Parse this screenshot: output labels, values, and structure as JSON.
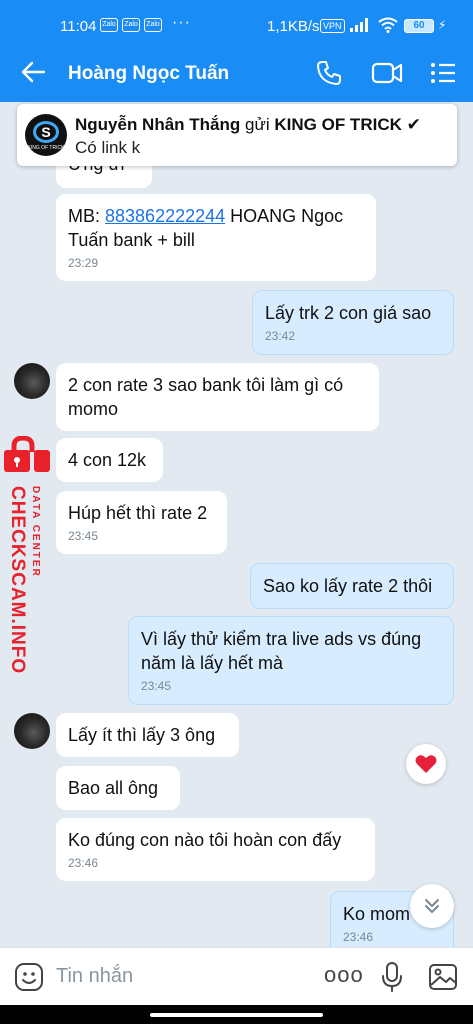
{
  "status_bar": {
    "time": "11:04",
    "app_icons": [
      "Zalo",
      "Zalo",
      "Zalo"
    ],
    "more": "···",
    "network_speed": "1,1KB/s",
    "vpn": "VPN",
    "battery": "60"
  },
  "header": {
    "contact_name": "Hoàng Ngọc Tuấn",
    "icons": [
      "back-arrow-icon",
      "phone-icon",
      "video-call-icon",
      "menu-list-icon"
    ]
  },
  "pinned_notification": {
    "sender": "Nguyễn Nhân Thắng",
    "action": "gửi",
    "target": "KING OF TRICK",
    "check": "✔",
    "preview": "Có link k",
    "logo_text": "KING OF TRICK"
  },
  "messages": [
    {
      "side": "in",
      "text": "Ừng ừi",
      "time": ""
    },
    {
      "side": "in",
      "prefix": "MB: ",
      "link": "883862222244",
      "text_line1_rest": " HOANG Ngoc",
      "text_line2": "Tuấn bank + bill",
      "time": "23:29"
    },
    {
      "side": "out",
      "text": "Lấy trk 2 con giá sao",
      "time": "23:42"
    },
    {
      "side": "in",
      "text_line1": "2 con rate 3 sao bank tôi làm gì có",
      "text_line2": "momo",
      "time": ""
    },
    {
      "side": "in",
      "text": "4 con 12k",
      "time": ""
    },
    {
      "side": "in",
      "text": "Húp hết thì rate 2",
      "time": "23:45"
    },
    {
      "side": "out",
      "text": "Sao ko lấy rate 2 thôi",
      "time": ""
    },
    {
      "side": "out",
      "text_line1": "Vì lấy thử kiểm tra live ads vs đúng",
      "text_line2": "năm là lấy hết mà",
      "time": "23:45"
    },
    {
      "side": "in",
      "text": "Lấy ít thì lấy 3 ông",
      "time": ""
    },
    {
      "side": "in",
      "text": "Bao all ông",
      "time": ""
    },
    {
      "side": "in",
      "text": "Ko đúng con nào tôi hoàn con đấy",
      "time": "23:46"
    },
    {
      "side": "out",
      "text": "Ko mom",
      "time": "23:46"
    }
  ],
  "watermark": {
    "main": "CHECKSCAM.INFO",
    "sub": "DATA CENTER"
  },
  "input": {
    "placeholder": "Tin nhắn",
    "more": "ooo"
  },
  "colors": {
    "brand_blue": "#1a8cf5",
    "outgoing_bubble": "#d7ecff",
    "incoming_bubble": "#ffffff",
    "chat_background": "#e2e9f1",
    "watermark_red": "#e8212b",
    "link": "#1a73e8"
  }
}
